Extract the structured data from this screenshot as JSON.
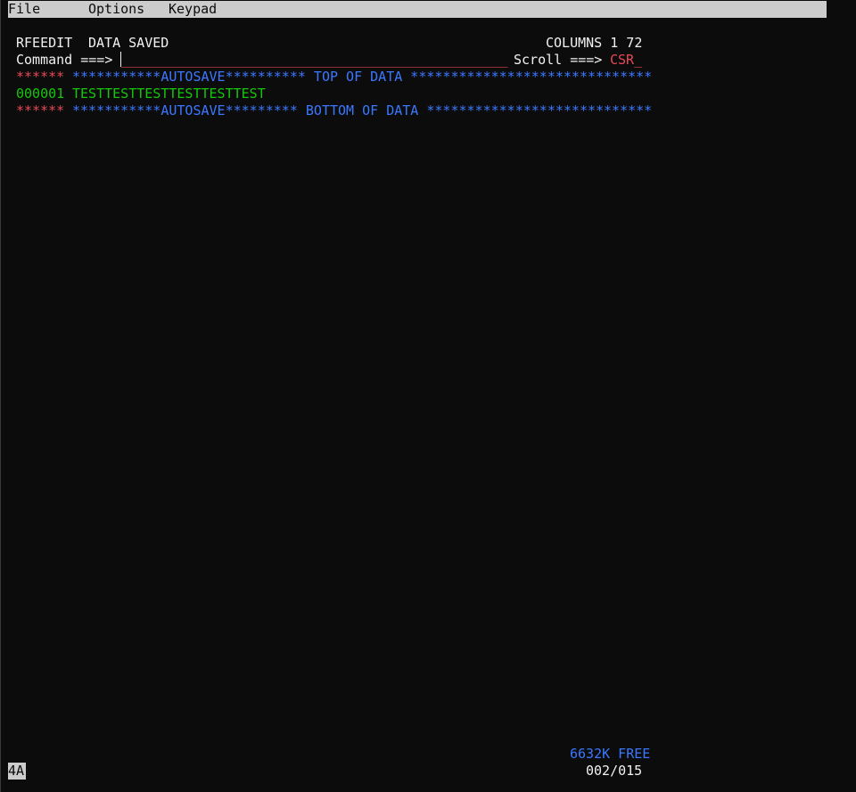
{
  "menubar": {
    "items": [
      "File",
      "Options",
      "Keypad"
    ]
  },
  "header": {
    "panel_name": "RFEEDIT",
    "status": "DATA SAVED",
    "columns": "COLUMNS 1 72"
  },
  "command": {
    "label": "Command ===>",
    "field": "________________________________________________",
    "scroll_label": "Scroll ===>",
    "scroll_value": "CSR_"
  },
  "editor": {
    "top_prefix": "******",
    "top_text": "***********AUTOSAVE********** TOP OF DATA ******************************",
    "data_lines": [
      {
        "number": "000001",
        "text": "TESTTESTTESTTESTTESTTEST"
      }
    ],
    "bottom_prefix": "******",
    "bottom_text": "***********AUTOSAVE********* BOTTOM OF DATA ****************************"
  },
  "footer": {
    "free_memory": "6632K FREE",
    "position": "002/015",
    "session": "4A"
  },
  "colors": {
    "background": "#0c0c0c",
    "text": "#f2f2f2",
    "red": "#e74856",
    "blue": "#3b78ff",
    "green": "#16c60c",
    "menubar": "#cccccc"
  }
}
